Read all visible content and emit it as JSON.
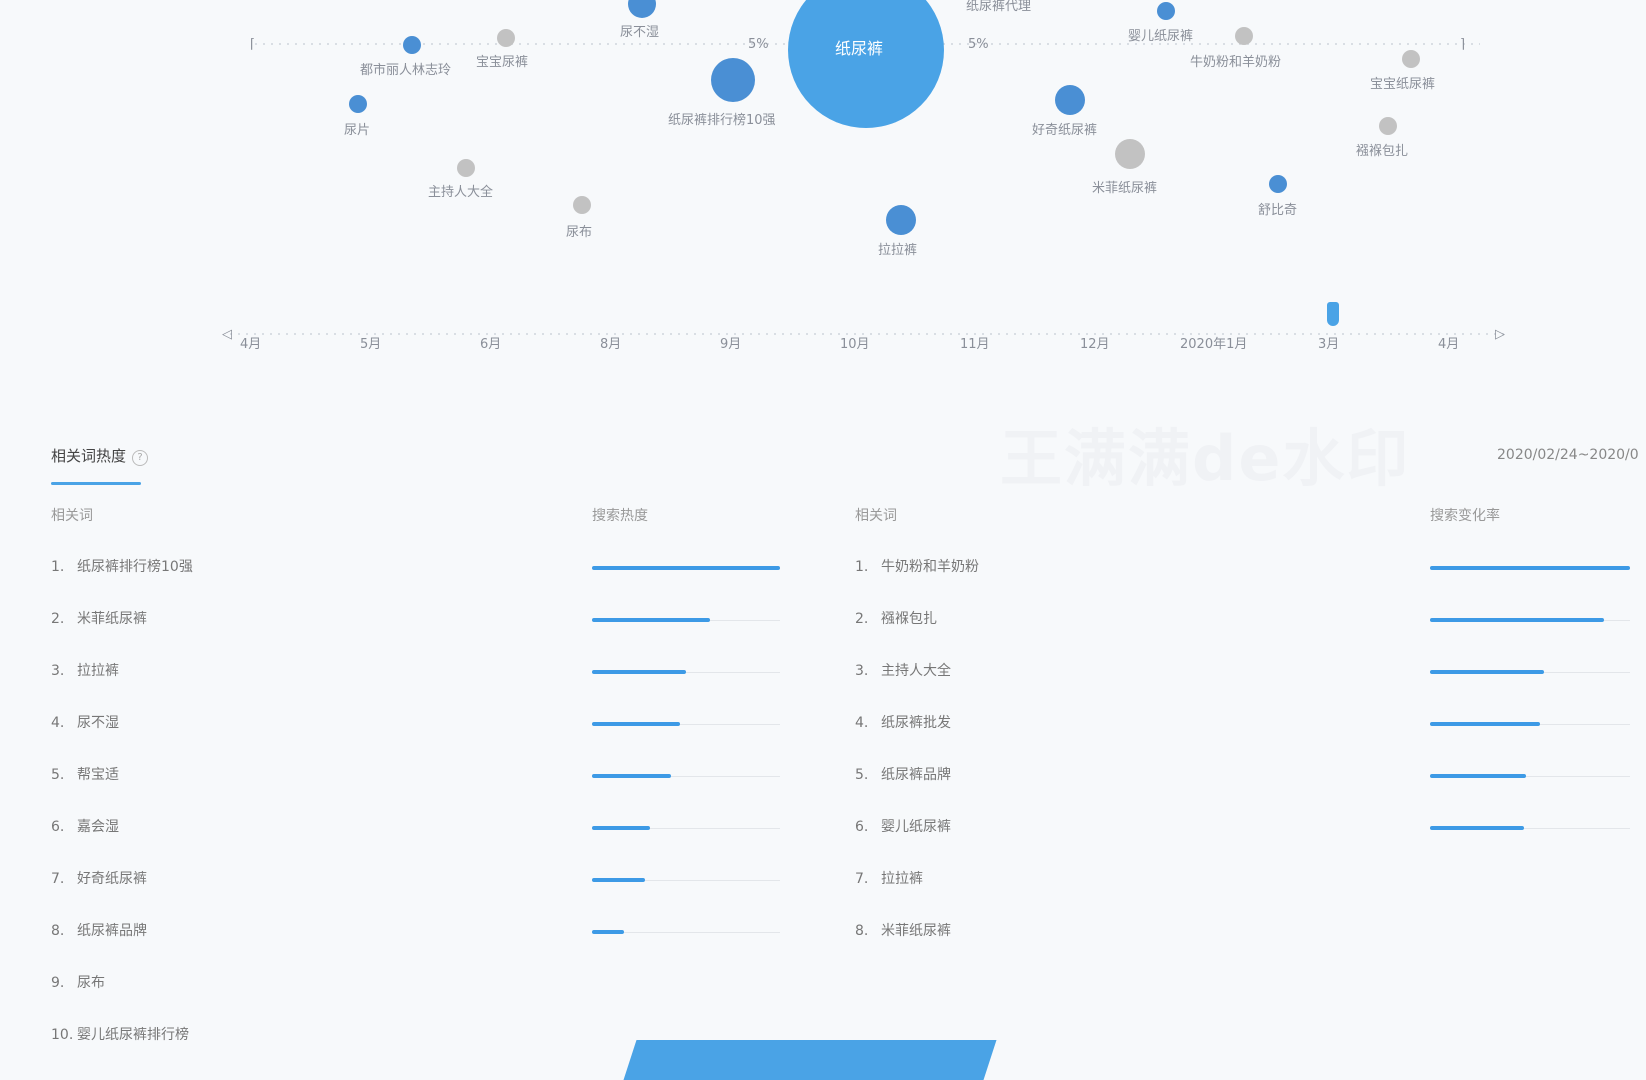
{
  "bubble_chart": {
    "top_labels": [
      "纸尿裤代理",
      "尿不湿"
    ],
    "main_bubble": "纸尿裤",
    "bubbles": [
      {
        "label": "都市丽人林志玲",
        "color": "#4a8fd4",
        "size": "small"
      },
      {
        "label": "宝宝尿裤",
        "color": "#c2c2c2",
        "size": "small"
      },
      {
        "label": "婴儿纸尿裤",
        "color": "#4a8fd4",
        "size": "small"
      },
      {
        "label": "牛奶粉和羊奶粉",
        "color": "#c2c2c2",
        "size": "small"
      },
      {
        "label": "尿片",
        "color": "#4a8fd4",
        "size": "small"
      },
      {
        "label": "纸尿裤排行榜10强",
        "color": "#4a8fd4",
        "size": "large"
      },
      {
        "label": "好奇纸尿裤",
        "color": "#4a8fd4",
        "size": "medium"
      },
      {
        "label": "宝宝纸尿裤",
        "color": "#c2c2c2",
        "size": "small"
      },
      {
        "label": "主持人大全",
        "color": "#c2c2c2",
        "size": "small"
      },
      {
        "label": "米菲纸尿裤",
        "color": "#c2c2c2",
        "size": "medium"
      },
      {
        "label": "襁褓包扎",
        "color": "#c2c2c2",
        "size": "small"
      },
      {
        "label": "尿布",
        "color": "#c2c2c2",
        "size": "small"
      },
      {
        "label": "舒比奇",
        "color": "#4a8fd4",
        "size": "small"
      },
      {
        "label": "拉拉裤",
        "color": "#4a8fd4",
        "size": "medium"
      }
    ],
    "side_ticks": [
      "5%",
      "5%"
    ],
    "timeline_ticks": [
      "4月",
      "5月",
      "6月",
      "8月",
      "9月",
      "10月",
      "11月",
      "12月",
      "2020年1月",
      "3月",
      "4月"
    ],
    "colors": {
      "blue": "#4aa3e6",
      "grey": "#c2c2c2",
      "dark_blue": "#4a8fd4"
    }
  },
  "panel": {
    "title": "相关词热度",
    "help_icon": "question-circle-icon",
    "date_range": "2020/02/24~2020/0",
    "watermark": "王满满de水印",
    "left": {
      "col_word": "相关词",
      "col_metric": "搜索热度",
      "rows": [
        {
          "idx": "1.",
          "word": "纸尿裤排行榜10强",
          "value": 1.0
        },
        {
          "idx": "2.",
          "word": "米菲纸尿裤",
          "value": 0.63
        },
        {
          "idx": "3.",
          "word": "拉拉裤",
          "value": 0.5
        },
        {
          "idx": "4.",
          "word": "尿不湿",
          "value": 0.47
        },
        {
          "idx": "5.",
          "word": "帮宝适",
          "value": 0.42
        },
        {
          "idx": "6.",
          "word": "嘉会湿",
          "value": 0.31
        },
        {
          "idx": "7.",
          "word": "好奇纸尿裤",
          "value": 0.28
        },
        {
          "idx": "8.",
          "word": "纸尿裤品牌",
          "value": 0.17
        },
        {
          "idx": "9.",
          "word": "尿布",
          "value": null
        },
        {
          "idx": "10.",
          "word": "婴儿纸尿裤排行榜",
          "value": null
        }
      ]
    },
    "right": {
      "col_word": "相关词",
      "col_metric": "搜索变化率",
      "rows": [
        {
          "idx": "1.",
          "word": "牛奶粉和羊奶粉",
          "value": 1.0
        },
        {
          "idx": "2.",
          "word": "襁褓包扎",
          "value": 0.87
        },
        {
          "idx": "3.",
          "word": "主持人大全",
          "value": 0.57
        },
        {
          "idx": "4.",
          "word": "纸尿裤批发",
          "value": 0.55
        },
        {
          "idx": "5.",
          "word": "纸尿裤品牌",
          "value": 0.48
        },
        {
          "idx": "6.",
          "word": "婴儿纸尿裤",
          "value": 0.47
        },
        {
          "idx": "7.",
          "word": "拉拉裤",
          "value": null
        },
        {
          "idx": "8.",
          "word": "米菲纸尿裤",
          "value": null
        }
      ]
    }
  }
}
